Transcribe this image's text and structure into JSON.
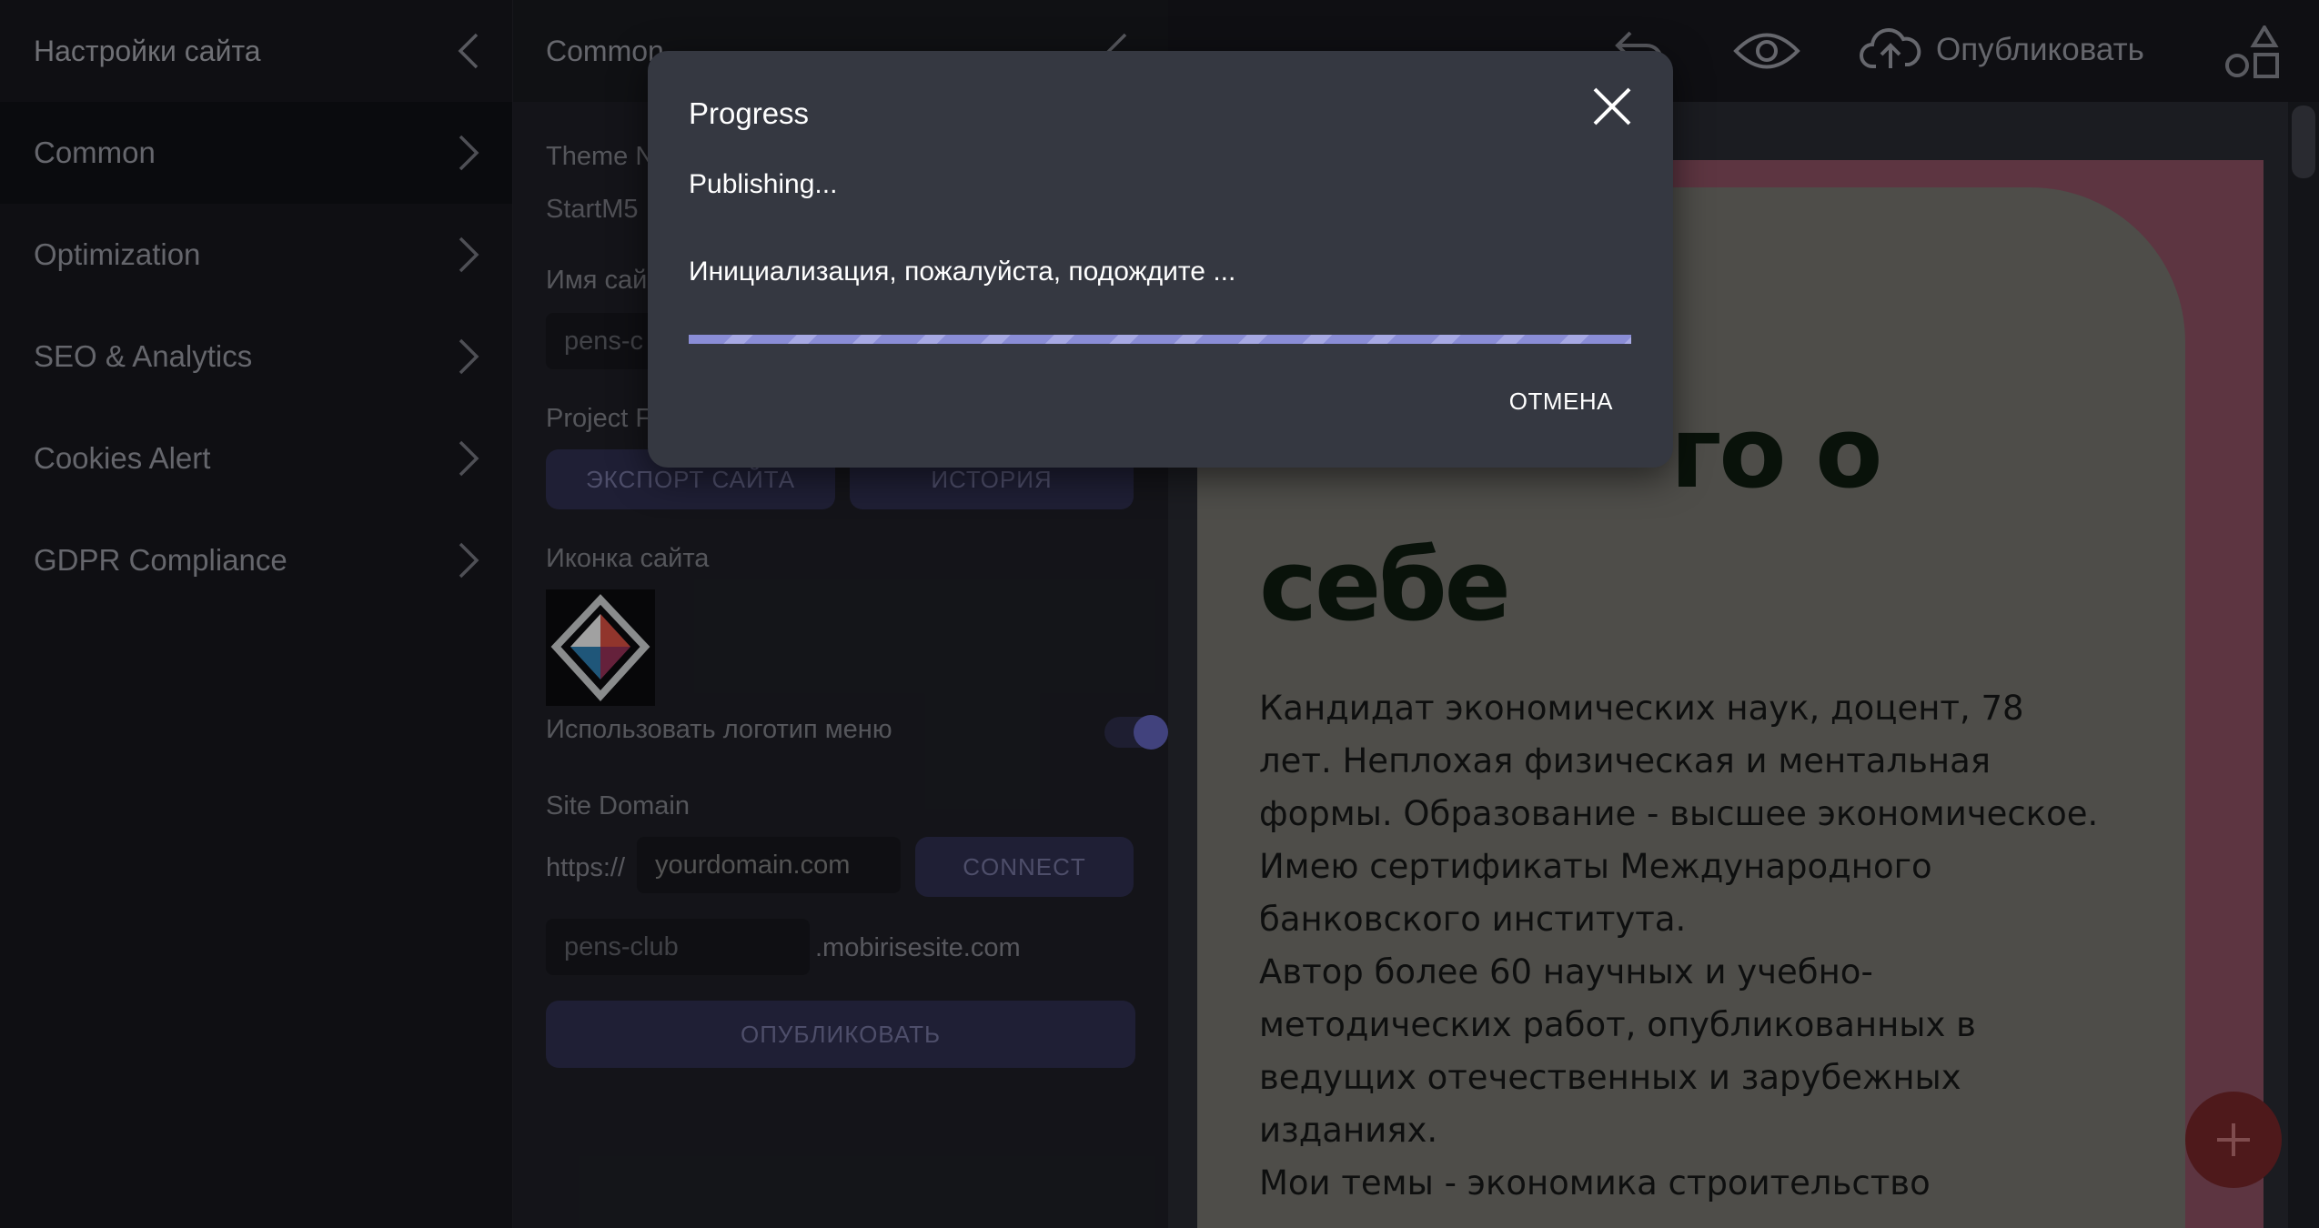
{
  "sidebar": {
    "title": "Настройки сайта",
    "items": [
      {
        "label": "Common"
      },
      {
        "label": "Optimization"
      },
      {
        "label": "SEO & Analytics"
      },
      {
        "label": "Cookies Alert"
      },
      {
        "label": "GDPR Compliance"
      }
    ]
  },
  "panel": {
    "title": "Common",
    "theme_label": "Theme N",
    "theme_value": "StartM5",
    "site_name_label": "Имя сай",
    "site_name_value": "pens-c",
    "project_label": "Project F",
    "export_button": "ЭКСПОРТ САЙТА",
    "history_button": "ИСТОРИЯ",
    "icon_label": "Иконка сайта",
    "use_logo_label": "Использовать логотип меню",
    "use_logo_enabled": true,
    "domain_label": "Site Domain",
    "domain_prefix": "https://",
    "domain_placeholder": "yourdomain.com",
    "connect_button": "CONNECT",
    "subdomain_value": "pens-club",
    "subdomain_suffix": ".mobirisesite.com",
    "publish_button": "ОПУБЛИКОВАТЬ"
  },
  "topbar": {
    "publish_label": "Опубликовать",
    "icons": [
      "undo-icon",
      "eye-icon",
      "cloud-upload-icon",
      "blocks-icon"
    ]
  },
  "preview": {
    "heading_line1": "го о",
    "heading_line2": "себе",
    "paragraphs": [
      "Кандидат экономических наук, доцент, 78 лет. Неплохая физическая и ментальная формы. Образование - высшее экономическое.",
      "Имею сертификаты Международного банковского института.",
      "Автор более 60 научных и учебно-методических работ, опубликованных в ведущих отечественных и зарубежных изданиях.",
      "Мои темы - экономика строительство"
    ]
  },
  "dialog": {
    "title": "Progress",
    "status": "Publishing...",
    "message": "Инициализация, пожалуйста, подождите ...",
    "cancel_label": "ОТМЕНА",
    "progress": 1.0
  },
  "colors": {
    "accent": "#5a5cae",
    "dialog_bg": "#353841",
    "progress": "#8a8dd6",
    "preview_frame": "#814a5a",
    "fab": "#6c2326"
  }
}
